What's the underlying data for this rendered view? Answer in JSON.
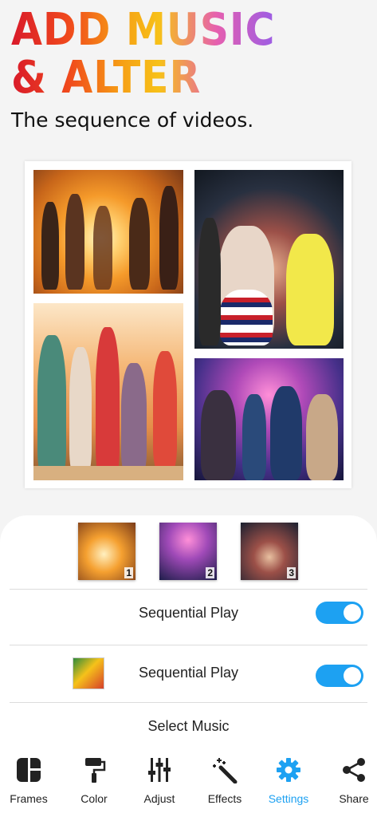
{
  "headline": {
    "line1": "ADD MUSIC",
    "line2": "& ALTER"
  },
  "subtitle": "The sequence of videos.",
  "thumbnails": [
    {
      "number": "1"
    },
    {
      "number": "2"
    },
    {
      "number": "3"
    }
  ],
  "settings": {
    "sequential_play_video": {
      "label": "Sequential Play",
      "enabled": true
    },
    "sequential_play_music": {
      "label": "Sequential Play",
      "enabled": true
    },
    "select_music": "Select Music"
  },
  "nav": [
    {
      "label": "Frames",
      "icon": "frames-icon",
      "active": false
    },
    {
      "label": "Color",
      "icon": "paint-roller-icon",
      "active": false
    },
    {
      "label": "Adjust",
      "icon": "sliders-icon",
      "active": false
    },
    {
      "label": "Effects",
      "icon": "magic-wand-icon",
      "active": false
    },
    {
      "label": "Settings",
      "icon": "gear-icon",
      "active": true
    },
    {
      "label": "Share",
      "icon": "share-icon",
      "active": false
    }
  ],
  "colors": {
    "accent": "#1da1f2",
    "text": "#222222"
  }
}
